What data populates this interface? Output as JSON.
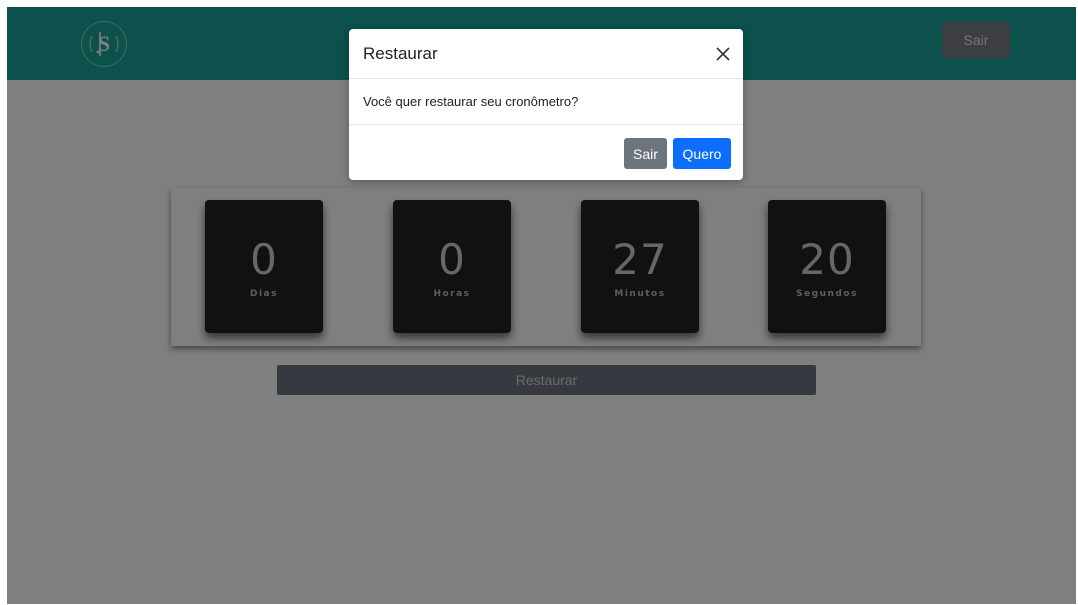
{
  "navbar": {
    "logo_icon": "monogram-logo-icon",
    "exit_label": "Sair",
    "color": "#18a398"
  },
  "timer": {
    "units": [
      {
        "value": "0",
        "label": "Dias"
      },
      {
        "value": "0",
        "label": "Horas"
      },
      {
        "value": "27",
        "label": "Minutos"
      },
      {
        "value": "20",
        "label": "Segundos"
      }
    ],
    "restore_label": "Restaurar"
  },
  "modal": {
    "title": "Restaurar",
    "close_icon": "close-icon",
    "message": "Você quer restaurar seu cronômetro?",
    "cancel_label": "Sair",
    "confirm_label": "Quero",
    "confirm_color": "#0d6efd",
    "cancel_color": "#6c757d"
  }
}
